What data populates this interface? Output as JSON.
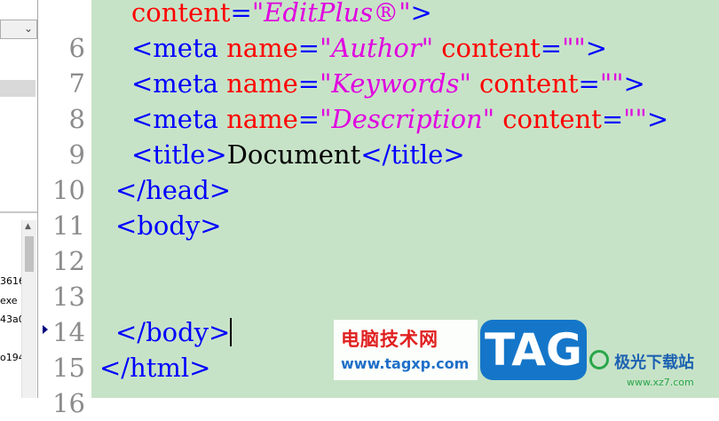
{
  "file_panel": {
    "files": [
      "3616",
      "exe",
      "43a0",
      "o194"
    ]
  },
  "gutter": {
    "line_numbers": [
      "6",
      "7",
      "8",
      "9",
      "10",
      "11",
      "12",
      "13",
      "14",
      "15",
      "16"
    ]
  },
  "code": {
    "line5": {
      "attr": "content",
      "eq": "=",
      "value": "\"EditPlus®\"",
      "close": ">"
    },
    "line6": {
      "tag": "<meta",
      "attr1": "name",
      "eq1": "=",
      "val1": "\"Author\"",
      "attr2": "content",
      "eq2": "=",
      "val2": "\"\"",
      "close": ">"
    },
    "line7": {
      "tag": "<meta",
      "attr1": "name",
      "eq1": "=",
      "val1": "\"Keywords\"",
      "attr2": "content",
      "eq2": "=",
      "val2": "\"\"",
      "close": ">"
    },
    "line8": {
      "tag": "<meta",
      "attr1": "name",
      "eq1": "=",
      "val1": "\"Description\"",
      "attr2": "content",
      "eq2": "=",
      "val2": "\"\"",
      "close": ">"
    },
    "line9": {
      "open": "<title>",
      "text": "Document",
      "close": "</title>"
    },
    "line10": "</head>",
    "line11": "<body>",
    "line14": "</body>",
    "line15": "</html>"
  },
  "watermark": {
    "cn_title": "电脑技术网",
    "url": "www.tagxp.com",
    "tag": "TAG",
    "site_cn": "极光下载站",
    "site_url": "www.xz7.com"
  }
}
